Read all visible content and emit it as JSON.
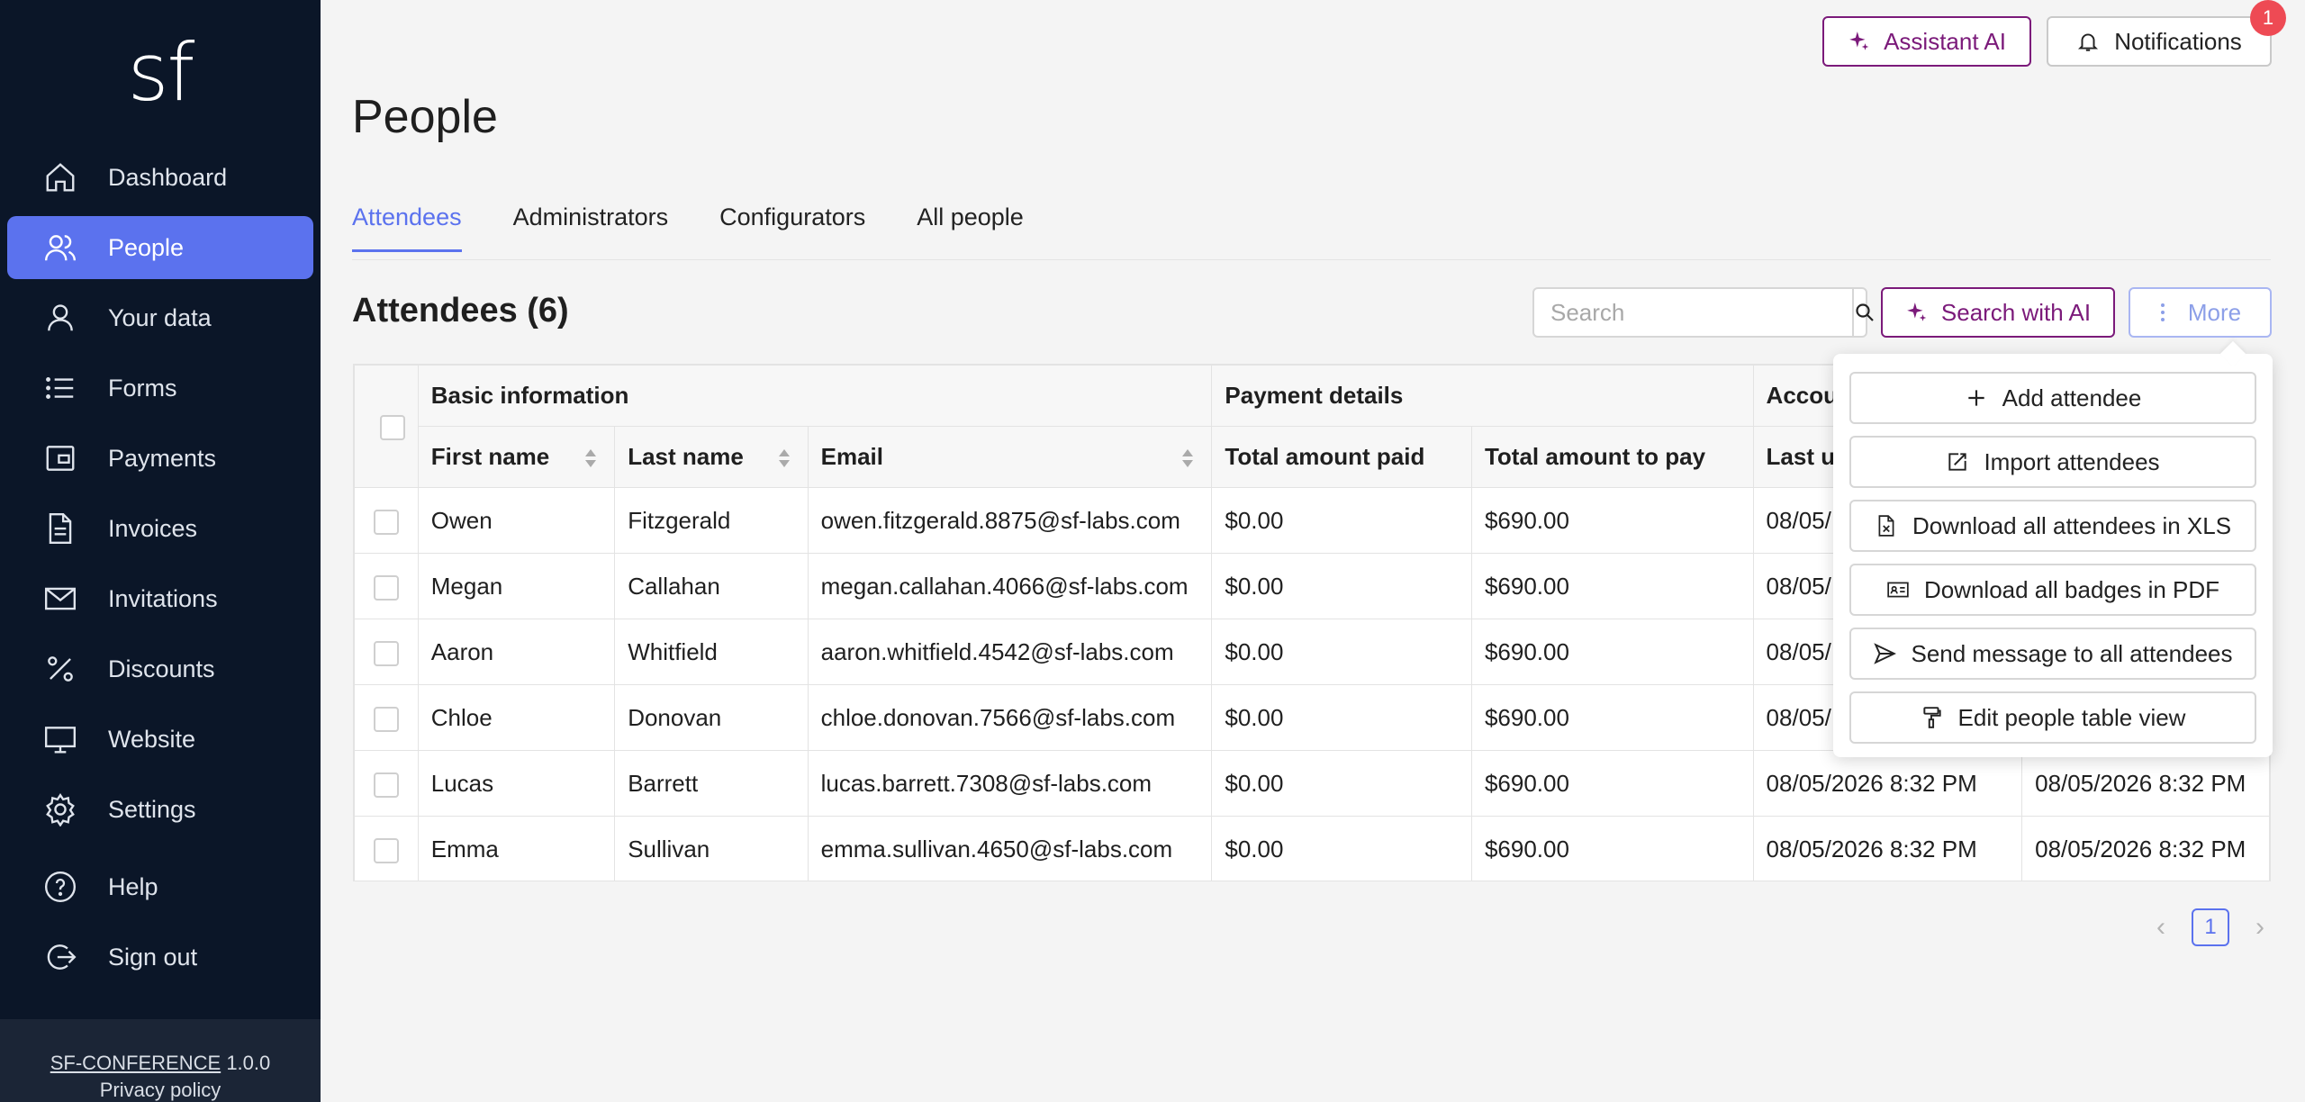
{
  "app": {
    "logo": "sf",
    "version": "1.0.0",
    "footer_link": "SF-CONFERENCE",
    "privacy": "Privacy policy"
  },
  "sidebar": {
    "items": [
      {
        "label": "Dashboard",
        "icon": "home-icon"
      },
      {
        "label": "People",
        "icon": "people-icon"
      },
      {
        "label": "Your data",
        "icon": "user-icon"
      },
      {
        "label": "Forms",
        "icon": "list-icon"
      },
      {
        "label": "Payments",
        "icon": "wallet-icon"
      },
      {
        "label": "Invoices",
        "icon": "document-icon"
      },
      {
        "label": "Invitations",
        "icon": "mail-icon"
      },
      {
        "label": "Discounts",
        "icon": "percent-icon"
      },
      {
        "label": "Website",
        "icon": "monitor-icon"
      },
      {
        "label": "Settings",
        "icon": "gear-icon"
      },
      {
        "label": "Help",
        "icon": "help-icon"
      },
      {
        "label": "Sign out",
        "icon": "sign-out-icon"
      }
    ]
  },
  "header": {
    "assistant_label": "Assistant AI",
    "notifications_label": "Notifications",
    "notifications_count": "1"
  },
  "page": {
    "title": "People",
    "section_title": "Attendees (6)"
  },
  "tabs": [
    {
      "label": "Attendees",
      "active": true
    },
    {
      "label": "Administrators"
    },
    {
      "label": "Configurators"
    },
    {
      "label": "All people"
    }
  ],
  "toolbar": {
    "search_placeholder": "Search",
    "search_ai_label": "Search with AI",
    "more_label": "More"
  },
  "table": {
    "groups": [
      "Basic information",
      "Payment details",
      "Accou"
    ],
    "columns": [
      "First name",
      "Last name",
      "Email",
      "Total amount paid",
      "Total amount to pay",
      "Last u",
      ""
    ],
    "rows": [
      [
        "Owen",
        "Fitzgerald",
        "owen.fitzgerald.8875@sf-labs.com",
        "$0.00",
        "$690.00",
        "08/05/",
        ""
      ],
      [
        "Megan",
        "Callahan",
        "megan.callahan.4066@sf-labs.com",
        "$0.00",
        "$690.00",
        "08/05/",
        ""
      ],
      [
        "Aaron",
        "Whitfield",
        "aaron.whitfield.4542@sf-labs.com",
        "$0.00",
        "$690.00",
        "08/05/",
        ""
      ],
      [
        "Chloe",
        "Donovan",
        "chloe.donovan.7566@sf-labs.com",
        "$0.00",
        "$690.00",
        "08/05/",
        ""
      ],
      [
        "Lucas",
        "Barrett",
        "lucas.barrett.7308@sf-labs.com",
        "$0.00",
        "$690.00",
        "08/05/2026 8:32 PM",
        "08/05/2026 8:32 PM"
      ],
      [
        "Emma",
        "Sullivan",
        "emma.sullivan.4650@sf-labs.com",
        "$0.00",
        "$690.00",
        "08/05/2026 8:32 PM",
        "08/05/2026 8:32 PM"
      ]
    ]
  },
  "dropdown": {
    "items": [
      {
        "label": "Add attendee",
        "icon": "plus-icon"
      },
      {
        "label": "Import attendees",
        "icon": "import-icon"
      },
      {
        "label": "Download all attendees in XLS",
        "icon": "xls-file-icon"
      },
      {
        "label": "Download all badges in PDF",
        "icon": "badge-icon"
      },
      {
        "label": "Send message to all attendees",
        "icon": "send-icon"
      },
      {
        "label": "Edit people table view",
        "icon": "paint-roller-icon"
      }
    ]
  },
  "pagination": {
    "current": "1"
  },
  "colors": {
    "accent": "#5b72ee",
    "ai": "#7b1a7a",
    "sidebar": "#0b1628",
    "badge": "#ee4a54"
  }
}
